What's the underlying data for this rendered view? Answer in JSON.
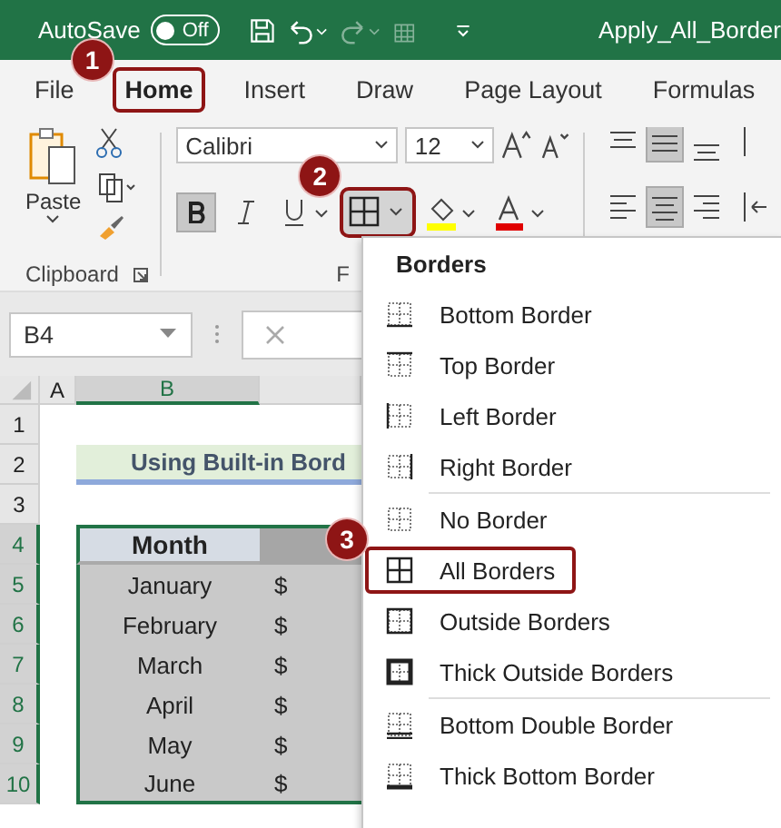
{
  "title_bar": {
    "autosave_label": "AutoSave",
    "autosave_toggle": {
      "label": "Off",
      "on": false
    },
    "file_name": "Apply_All_Border"
  },
  "tabs": [
    {
      "label": "File",
      "selected": false
    },
    {
      "label": "Home",
      "selected": true,
      "callout": "1"
    },
    {
      "label": "Insert",
      "selected": false
    },
    {
      "label": "Draw",
      "selected": false
    },
    {
      "label": "Page Layout",
      "selected": false
    },
    {
      "label": "Formulas",
      "selected": false
    }
  ],
  "ribbon": {
    "paste_label": "Paste",
    "font_name": "Calibri",
    "font_size": "12",
    "bold_on": true,
    "borders_button": {
      "callout": "2"
    },
    "group_labels": [
      "Clipboard",
      "F"
    ]
  },
  "formula_bar": {
    "name_box": "B4"
  },
  "sheet": {
    "columns": [
      {
        "label": "A",
        "selected": false
      },
      {
        "label": "B",
        "selected": true
      }
    ],
    "rows": [
      {
        "label": "1",
        "selected": false
      },
      {
        "label": "2",
        "selected": false
      },
      {
        "label": "3",
        "selected": false
      },
      {
        "label": "4",
        "selected": true
      },
      {
        "label": "5",
        "selected": true
      },
      {
        "label": "6",
        "selected": true
      },
      {
        "label": "7",
        "selected": true
      },
      {
        "label": "8",
        "selected": true
      },
      {
        "label": "9",
        "selected": true
      },
      {
        "label": "10",
        "selected": true
      }
    ],
    "heading": "Using Built-in Bord",
    "table_header": "Month",
    "table_rows": [
      {
        "month": "January",
        "currency": "$"
      },
      {
        "month": "February",
        "currency": "$"
      },
      {
        "month": "March",
        "currency": "$"
      },
      {
        "month": "April",
        "currency": "$"
      },
      {
        "month": "May",
        "currency": "$"
      },
      {
        "month": "June",
        "currency": "$"
      }
    ]
  },
  "borders_menu": {
    "title": "Borders",
    "items": [
      {
        "label": "Bottom Border",
        "kind": "bottom",
        "separator_before": false
      },
      {
        "label": "Top Border",
        "kind": "top",
        "separator_before": false
      },
      {
        "label": "Left Border",
        "kind": "left",
        "separator_before": false
      },
      {
        "label": "Right Border",
        "kind": "right",
        "separator_before": false
      },
      {
        "label": "No Border",
        "kind": "none",
        "separator_before": true
      },
      {
        "label": "All Borders",
        "kind": "all",
        "separator_before": false,
        "callout": "3"
      },
      {
        "label": "Outside Borders",
        "kind": "outside",
        "separator_before": false
      },
      {
        "label": "Thick Outside Borders",
        "kind": "thick_outside",
        "separator_before": false
      },
      {
        "label": "Bottom Double Border",
        "kind": "bottom_double",
        "separator_before": true
      },
      {
        "label": "Thick Bottom Border",
        "kind": "thick_bottom",
        "separator_before": false
      }
    ]
  }
}
